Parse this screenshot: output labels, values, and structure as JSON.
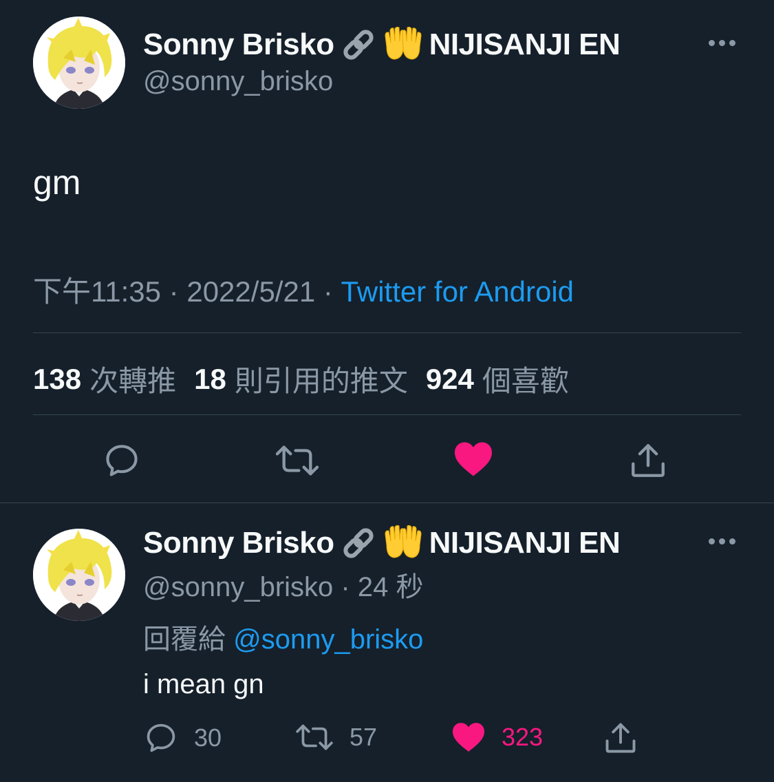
{
  "main_tweet": {
    "display_name": "Sonny Brisko",
    "affiliation": "NIJISANJI EN",
    "handle": "@sonny_brisko",
    "text": "gm",
    "time": "下午11:35",
    "date": "2022/5/21",
    "source": "Twitter for Android",
    "separator": "·",
    "stats": {
      "retweets_count": "138",
      "retweets_label": "次轉推",
      "quotes_count": "18",
      "quotes_label": "則引用的推文",
      "likes_count": "924",
      "likes_label": "個喜歡"
    },
    "icons": [
      "link-emoji",
      "raising-hands-emoji",
      "more-icon",
      "reply-icon",
      "retweet-icon",
      "like-icon",
      "share-icon"
    ]
  },
  "reply_tweet": {
    "display_name": "Sonny Brisko",
    "affiliation": "NIJISANJI EN",
    "handle": "@sonny_brisko",
    "time_ago": "24 秒",
    "separator": "·",
    "reply_prefix": "回覆給",
    "reply_handle": "@sonny_brisko",
    "text": "i mean gn",
    "reply_count": "30",
    "retweet_count": "57",
    "like_count": "323"
  },
  "colors": {
    "background": "#15202b",
    "text": "#f7f9f9",
    "secondary": "#8b98a5",
    "link": "#1d9bf0",
    "like": "#f91880",
    "divider": "#38444d"
  }
}
